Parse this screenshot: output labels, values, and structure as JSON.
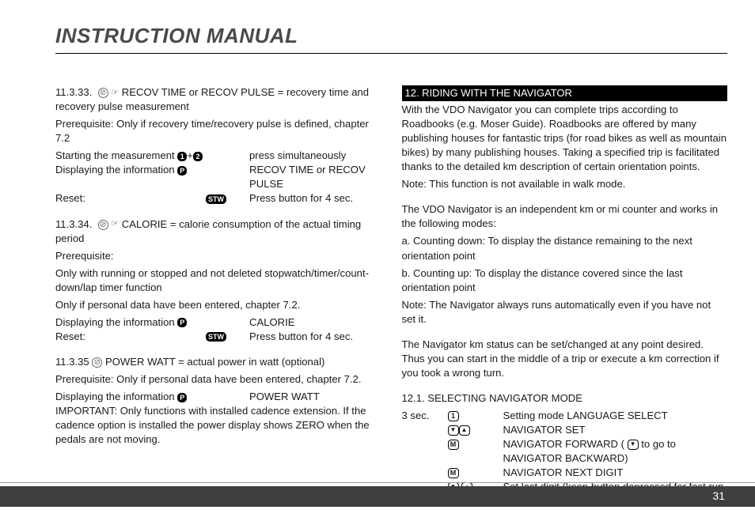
{
  "header": {
    "title": "INSTRUCTION MANUAL"
  },
  "footer": {
    "page": "31"
  },
  "left": {
    "s33": {
      "head": "11.3.33.    ",
      "title": " RECOV TIME or RECOV PULSE = recovery time and recovery pulse measurement",
      "prereq": "Prerequisite: Only if recovery time/recovery pulse is defined, chapter 7.2",
      "r1_label": "Starting the measurement ",
      "r1_val": "press simultaneously",
      "r2_label": "Displaying the information ",
      "r2_val": "RECOV TIME or RECOV PULSE",
      "r3_label": "Reset:",
      "r3_val": "Press button for 4 sec."
    },
    "s34": {
      "head": "11.3.34.    ",
      "title": " CALORIE = calorie consumption of the actual timing period",
      "prereq_lbl": "Prerequisite:",
      "prereq_1": "Only with running or stopped and not deleted stopwatch/timer/count-down/lap timer function",
      "prereq_2": "Only if personal data have been entered, chapter 7.2.",
      "r1_label": "Displaying the information ",
      "r1_val": "CALORIE",
      "r2_label": "Reset:",
      "r2_val": "Press button for 4 sec."
    },
    "s35": {
      "head": "11.3.35   ",
      "title": "  POWER WATT = actual power in watt (optional)",
      "prereq": "Prerequisite: Only if personal data have been entered, chapter 7.2.",
      "r1_label": "Displaying the information ",
      "r1_val": "POWER WATT",
      "note": "IMPORTANT: Only functions with installed cadence extension. If the cadence option is installed the power display shows ZERO when the pedals are not moving."
    }
  },
  "right": {
    "section_title": " 12. RIDING WITH THE NAVIGATOR",
    "p1": "With the VDO Navigator you can complete trips according to Roadbooks (e.g. Moser Guide). Roadbooks are offered by many publishing houses for fantastic trips (for road bikes as well as mountain bikes) by many publishing houses. Taking a specified trip is facilitated thanks to the detailed km description of certain orientation points.",
    "p1_note": "Note: This function is not available in walk mode.",
    "p2_intro": "The VDO Navigator is an independent km or mi counter and works in the following modes:",
    "p2_a": "a. Counting down: To display the distance remaining to the next orientation point",
    "p2_b": "b. Counting up: To display the distance covered since the last orientation point",
    "p2_note": "Note: The Navigator always runs automatically even if you have not set it.",
    "p3": "The Navigator km status can be set/changed at any point desired. Thus you can start in the middle of a trip or execute a km correction if you took a wrong turn.",
    "s121": {
      "title": "12.1. SELECTING NAVIGATOR MODE",
      "r1_c1": "3 sec.",
      "r1_val": "Setting mode LANGUAGE SELECT",
      "r2_val": "NAVIGATOR SET",
      "r3_val_a": "NAVIGATOR FORWARD ( ",
      "r3_val_b": " to go to NAVIGATOR BACKWARD)",
      "r4_val": "NAVIGATOR NEXT DIGIT",
      "r5_val": "Set last digit (keep button depressed for fast run-"
    }
  }
}
